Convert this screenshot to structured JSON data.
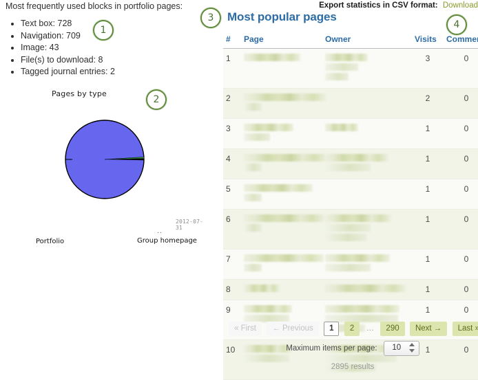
{
  "left": {
    "blocks_intro": "Most frequently used blocks in portfolio pages:",
    "blocks": [
      "Text box: 728",
      "Navigation: 709",
      "Image: 43",
      "File(s) to download: 8",
      "Tagged journal entries: 2"
    ]
  },
  "chart_data": {
    "type": "pie",
    "title": "Pages by type",
    "date_stamp": "2012-07-31",
    "labels": [
      "Portfolio",
      "Group homepage",
      ".."
    ],
    "values": [
      99.2,
      0.5,
      0.3
    ],
    "colors": [
      "#6666ee",
      "#000000",
      "#3a9c4a"
    ],
    "legend": "labels-outside",
    "grid": false
  },
  "right": {
    "export_label": "Export statistics in CSV format:",
    "download_label": "Download",
    "title": "Most popular pages",
    "columns": [
      "#",
      "Page",
      "Owner",
      "Visits",
      "Comments"
    ],
    "rows": [
      {
        "num": "1",
        "visits": "3",
        "comments": "0",
        "page_lines": 1,
        "owner_lines": 3
      },
      {
        "num": "2",
        "visits": "2",
        "comments": "0",
        "page_lines": 2,
        "owner_lines": 0
      },
      {
        "num": "3",
        "visits": "1",
        "comments": "0",
        "page_lines": 2,
        "owner_lines": 1
      },
      {
        "num": "4",
        "visits": "1",
        "comments": "0",
        "page_lines": 2,
        "owner_lines": 2
      },
      {
        "num": "5",
        "visits": "1",
        "comments": "0",
        "page_lines": 2,
        "owner_lines": 0
      },
      {
        "num": "6",
        "visits": "1",
        "comments": "0",
        "page_lines": 2,
        "owner_lines": 3
      },
      {
        "num": "7",
        "visits": "1",
        "comments": "0",
        "page_lines": 2,
        "owner_lines": 2
      },
      {
        "num": "8",
        "visits": "1",
        "comments": "0",
        "page_lines": 1,
        "owner_lines": 1
      },
      {
        "num": "9",
        "visits": "1",
        "comments": "0",
        "page_lines": 2,
        "owner_lines": 3
      },
      {
        "num": "10",
        "visits": "1",
        "comments": "0",
        "page_lines": 2,
        "owner_lines": 3
      }
    ],
    "pagination": {
      "first": "« First",
      "previous": "← Previous",
      "page_1": "1",
      "page_2": "2",
      "ellipsis": "…",
      "page_last": "290",
      "next": "Next →",
      "last": "Last »"
    },
    "perpage_label": "Maximum items per page:",
    "perpage_value": "10",
    "results": "2895 results"
  },
  "callouts": {
    "one": "1",
    "two": "2",
    "three": "3",
    "four": "4"
  },
  "colors": {
    "heading_blue": "#2d6ca5",
    "link_olive": "#8a9a2b",
    "pie_blue": "#6666ee",
    "callout_green": "#5f8a3a",
    "row_tint": "#f1f4e7"
  }
}
